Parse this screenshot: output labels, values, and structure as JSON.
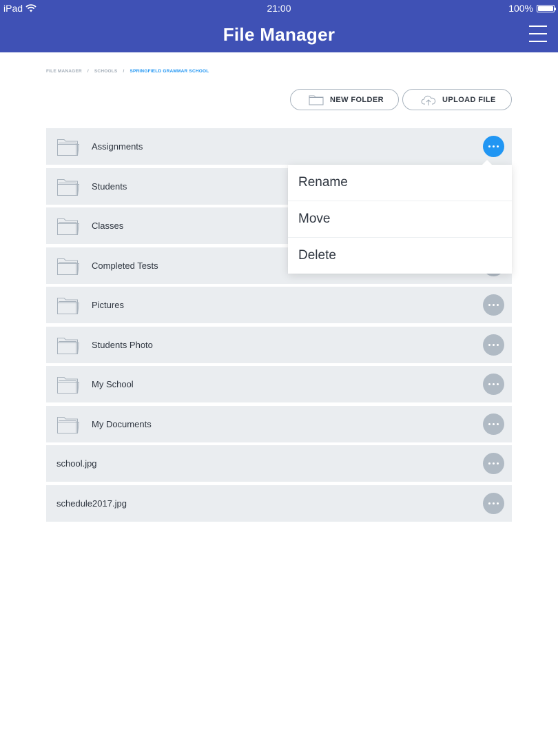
{
  "status": {
    "device": "iPad",
    "time": "21:00",
    "battery": "100%"
  },
  "header": {
    "title": "File Manager"
  },
  "breadcrumb": [
    {
      "label": "FILE MANAGER",
      "current": false
    },
    {
      "label": "SCHOOLS",
      "current": false
    },
    {
      "label": "SPRINGFIELD GRAMMAR SCHOOL",
      "current": true
    }
  ],
  "breadcrumb_separator": "/",
  "toolbar": {
    "new_folder_label": "NEW FOLDER",
    "upload_label": "UPLOAD FILE"
  },
  "items": [
    {
      "name": "Assignments",
      "type": "folder",
      "menu_open": true
    },
    {
      "name": "Students",
      "type": "folder"
    },
    {
      "name": "Classes",
      "type": "folder"
    },
    {
      "name": "Completed Tests",
      "type": "folder"
    },
    {
      "name": "Pictures",
      "type": "folder"
    },
    {
      "name": "Students Photo",
      "type": "folder"
    },
    {
      "name": "My School",
      "type": "folder"
    },
    {
      "name": "My Documents",
      "type": "folder"
    },
    {
      "name": "school.jpg",
      "type": "file"
    },
    {
      "name": "schedule2017.jpg",
      "type": "file"
    }
  ],
  "context_menu": {
    "items": [
      "Rename",
      "Move",
      "Delete"
    ]
  },
  "colors": {
    "brand": "#3f51b5",
    "accent": "#2196f3",
    "row_bg": "#eaedf0",
    "more_inactive": "#b0bac4"
  },
  "icons": {
    "folder": "folder-icon",
    "upload": "cloud-upload-icon",
    "more": "more-horizontal-icon",
    "menu": "hamburger-menu-icon",
    "wifi": "wifi-icon",
    "battery": "battery-icon"
  }
}
